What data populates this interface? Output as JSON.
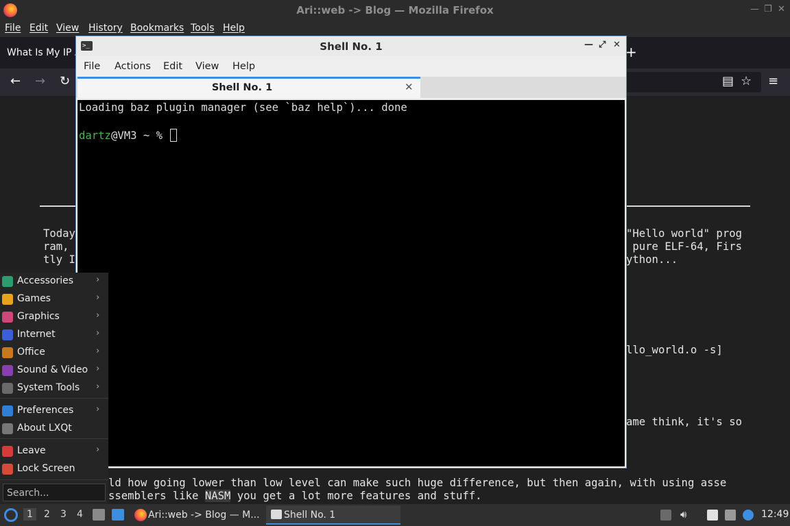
{
  "firefox": {
    "title": "Ari::web -> Blog — Mozilla Firefox",
    "menu": [
      "File",
      "Edit",
      "View",
      "History",
      "Bookmarks",
      "Tools",
      "Help"
    ],
    "tab_label": "What Is My IP A",
    "newtab_glyph": "+",
    "nav": {
      "back": "←",
      "forward": "→",
      "reload": "↻",
      "reader": "▤",
      "star": "☆",
      "menu": "≡"
    }
  },
  "page": {
    "lines": [
      {
        "left": "Today",
        "right": "\"Hello world\" prog"
      },
      {
        "left": "ram,",
        "right": " pure ELF-64, Firs"
      },
      {
        "left": "tly I",
        "right": "ython..."
      }
    ],
    "frag_obj": "llo_world.o -s]",
    "frag_think": "ame think, it's so",
    "bottom_line1": "ld how going lower than low level can make such huge difference, but then again, with using asse",
    "bottom_line2_pre": "ssemblers like ",
    "bottom_line2_hl": "NASM",
    "bottom_line2_post": " you get a lot more features and stuff."
  },
  "terminal": {
    "title": "Shell No. 1",
    "menu": [
      "File",
      "Actions",
      "Edit",
      "View",
      "Help"
    ],
    "tab_label": "Shell No. 1",
    "line1": "Loading baz plugin manager (see `baz help`)... done",
    "prompt_user": "dartz",
    "prompt_rest": "@VM3 ~ % "
  },
  "start_menu": {
    "items": [
      {
        "label": "Accessories",
        "icon": "accessories-icon",
        "color": "#2e9b6f",
        "submenu": true
      },
      {
        "label": "Games",
        "icon": "games-icon",
        "color": "#e8a31c",
        "submenu": true
      },
      {
        "label": "Graphics",
        "icon": "graphics-icon",
        "color": "#d0457a",
        "submenu": true
      },
      {
        "label": "Internet",
        "icon": "internet-icon",
        "color": "#3b5fd8",
        "submenu": true
      },
      {
        "label": "Office",
        "icon": "office-icon",
        "color": "#c8791d",
        "submenu": true
      },
      {
        "label": "Sound & Video",
        "icon": "sound-video-icon",
        "color": "#8a3fb0",
        "submenu": true
      },
      {
        "label": "System Tools",
        "icon": "system-tools-icon",
        "color": "#6a6a6a",
        "submenu": true
      },
      {
        "label": "Preferences",
        "icon": "preferences-icon",
        "color": "#2f7fd6",
        "submenu": true
      },
      {
        "label": "About LXQt",
        "icon": "about-icon",
        "color": "#777777",
        "submenu": false
      },
      {
        "label": "Leave",
        "icon": "leave-icon",
        "color": "#d63a3a",
        "submenu": true
      },
      {
        "label": "Lock Screen",
        "icon": "lock-icon",
        "color": "#d64a3a",
        "submenu": false
      }
    ],
    "arrow": "›",
    "search_placeholder": "Search..."
  },
  "taskbar": {
    "workspaces": [
      "1",
      "2",
      "3",
      "4"
    ],
    "tasks": [
      "Ari::web -> Blog — M...",
      "Shell No. 1"
    ],
    "clock": "12:49"
  }
}
